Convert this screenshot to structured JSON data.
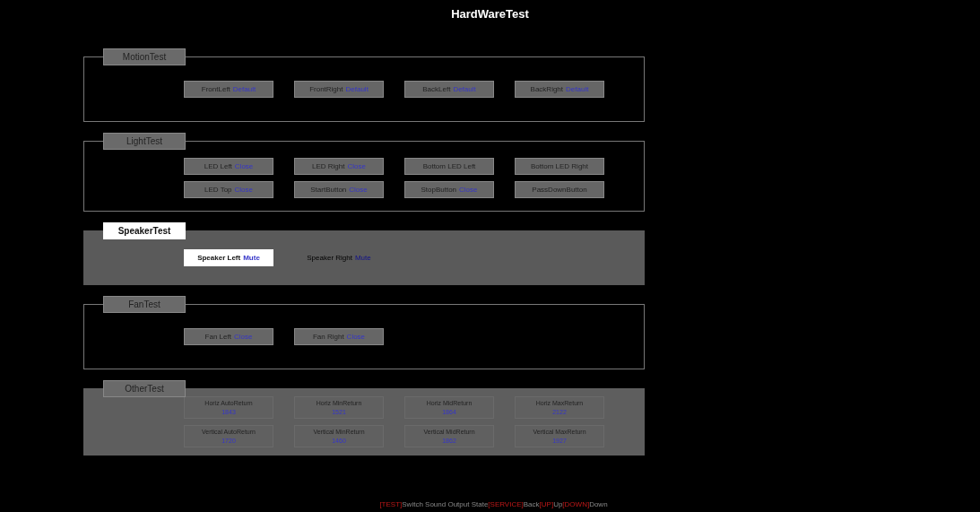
{
  "title": "HardWareTest",
  "sections": [
    {
      "label": "MotionTest",
      "kind": "toggle",
      "selected": false,
      "items": [
        {
          "name": "FrontLeft",
          "value": "Default",
          "selected": false
        },
        {
          "name": "FrontRight",
          "value": "Default",
          "selected": false
        },
        {
          "name": "BackLeft",
          "value": "Default",
          "selected": false
        },
        {
          "name": "BackRight",
          "value": "Default",
          "selected": false
        }
      ]
    },
    {
      "label": "LightTest",
      "kind": "toggle",
      "selected": false,
      "items": [
        {
          "name": "LED Left",
          "value": "Close",
          "selected": false
        },
        {
          "name": "LED Right",
          "value": "Close",
          "selected": false
        },
        {
          "name": "Bottom LED Left",
          "selected": false
        },
        {
          "name": "Bottom LED Right",
          "selected": false
        },
        {
          "name": "LED Top",
          "value": "Close",
          "selected": false
        },
        {
          "name": "StartButton",
          "value": "Close",
          "selected": false
        },
        {
          "name": "StopButton",
          "value": "Close",
          "selected": false
        },
        {
          "name": "PassDownButton",
          "selected": false
        }
      ]
    },
    {
      "label": "SpeakerTest",
      "kind": "toggle",
      "selected": true,
      "items": [
        {
          "name": "Speaker Left",
          "value": "Mute",
          "selected": true
        },
        {
          "name": "Speaker Right",
          "value": "Mute",
          "selected": false
        }
      ]
    },
    {
      "label": "FanTest",
      "kind": "toggle",
      "selected": false,
      "items": [
        {
          "name": "Fan Left",
          "value": "Close",
          "selected": false
        },
        {
          "name": "Fan Right",
          "value": "Close",
          "selected": false
        }
      ]
    },
    {
      "label": "OtherTest",
      "kind": "reading",
      "selected": false,
      "items": [
        {
          "name": "Horiz AutoReturn",
          "value": "1843",
          "selected": false
        },
        {
          "name": "Horiz MinReturn",
          "value": "1521",
          "selected": false
        },
        {
          "name": "Horiz MidReturn",
          "value": "1864",
          "selected": false
        },
        {
          "name": "Horiz MaxReturn",
          "value": "2122",
          "selected": false
        },
        {
          "name": "Vertical AutoReturn",
          "value": "1720",
          "selected": false
        },
        {
          "name": "Vertical MinReturn",
          "value": "1460",
          "selected": false
        },
        {
          "name": "Vertical MidReturn",
          "value": "1862",
          "selected": false
        },
        {
          "name": "Vertical MaxReturn",
          "value": "1927",
          "selected": false
        }
      ]
    }
  ],
  "footer": [
    {
      "key": "[TEST]",
      "text": "Switch Sound Output State"
    },
    {
      "key": "[SERVICE]",
      "text": "Back"
    },
    {
      "key": "[UP]",
      "text": "Up"
    },
    {
      "key": "[DOWN]",
      "text": "Down"
    }
  ]
}
